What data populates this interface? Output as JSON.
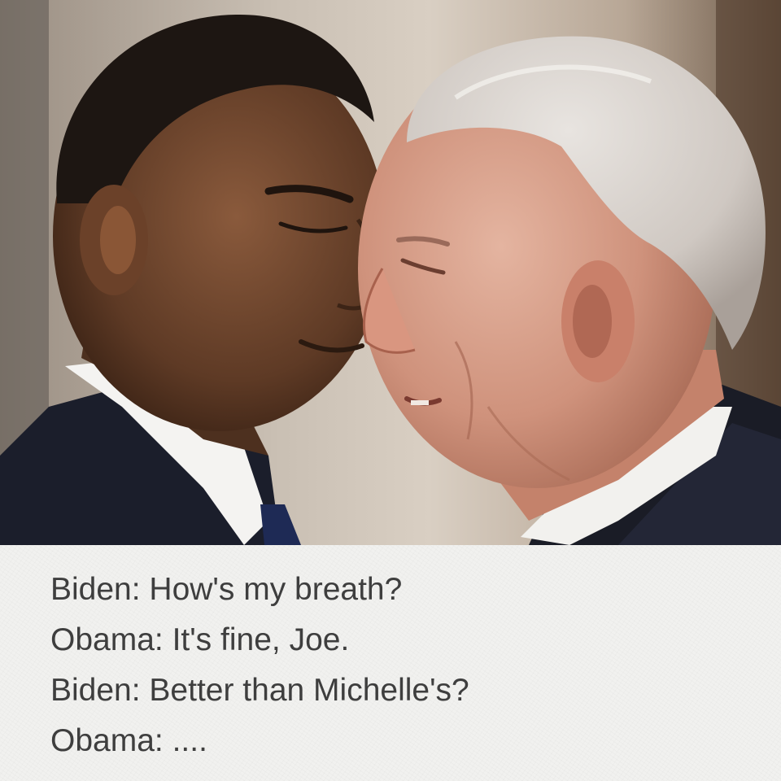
{
  "photo": {
    "description_icon": "photo-two-men-face-to-face"
  },
  "caption": {
    "lines": [
      "Biden: How's my breath?",
      "Obama: It's fine, Joe.",
      "Biden: Better than Michelle's?",
      "Obama: ...."
    ]
  },
  "colors": {
    "caption_background": "#f1f1ef",
    "caption_text": "#3e3e3e"
  }
}
